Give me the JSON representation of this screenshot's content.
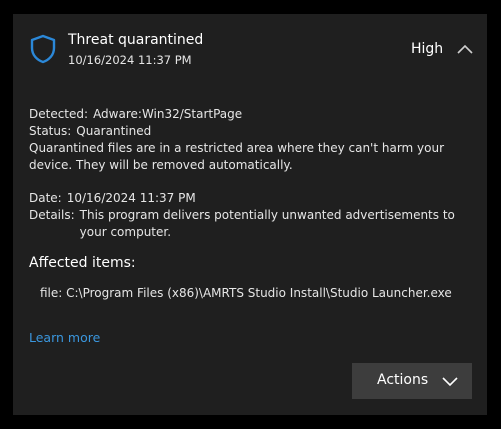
{
  "header": {
    "title": "Threat quarantined",
    "timestamp": "10/16/2024 11:37 PM",
    "severity": "High",
    "shield_icon": "shield-icon",
    "accent_color": "#2b88d8"
  },
  "details": {
    "detected_label": "Detected:",
    "detected_value": "Adware:Win32/StartPage",
    "status_label": "Status:",
    "status_value": "Quarantined",
    "status_description": "Quarantined files are in a restricted area where they can't harm your device. They will be removed automatically.",
    "date_label": "Date:",
    "date_value": "10/16/2024 11:37 PM",
    "details_label": "Details:",
    "details_value": "This program delivers potentially unwanted advertisements to your computer."
  },
  "affected": {
    "heading": "Affected items:",
    "items": [
      "file: C:\\Program Files (x86)\\AMRTS Studio Install\\Studio Launcher.exe"
    ]
  },
  "links": {
    "learn_more": "Learn more",
    "link_color": "#3a96dd"
  },
  "actions": {
    "label": "Actions"
  }
}
